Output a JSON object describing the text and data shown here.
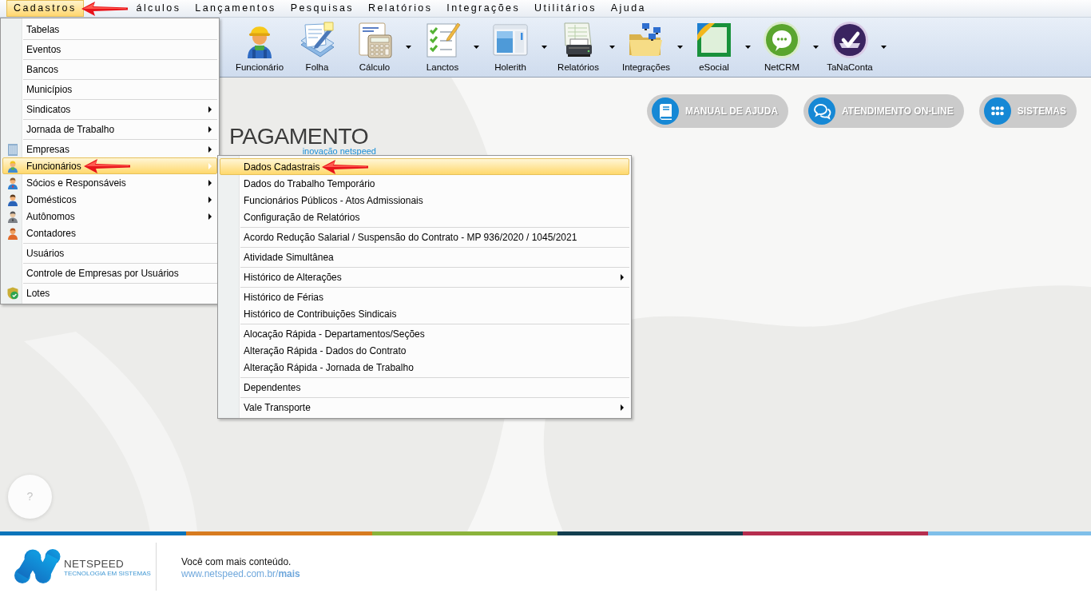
{
  "menubar": {
    "items": [
      {
        "label": "Cadastros",
        "selected": true,
        "marked": true
      },
      {
        "label": "álculos",
        "selected": false,
        "marked": false
      },
      {
        "label": "Lançamentos",
        "selected": false,
        "marked": false
      },
      {
        "label": "Pesquisas",
        "selected": false,
        "marked": false
      },
      {
        "label": "Relatórios",
        "selected": false,
        "marked": false
      },
      {
        "label": "Integrações",
        "selected": false,
        "marked": false
      },
      {
        "label": "Utilitários",
        "selected": false,
        "marked": false
      },
      {
        "label": "Ajuda",
        "selected": false,
        "marked": false
      }
    ]
  },
  "toolbar": {
    "items": [
      {
        "label": "Funcionário",
        "kind": "employee",
        "dropdown": false
      },
      {
        "label": "Folha",
        "kind": "payroll",
        "dropdown": false
      },
      {
        "label": "Cálculo",
        "kind": "calculator",
        "dropdown": true
      },
      {
        "label": "Lanctos",
        "kind": "checklist",
        "dropdown": true
      },
      {
        "label": "Holerith",
        "kind": "window",
        "dropdown": true
      },
      {
        "label": "Relatórios",
        "kind": "printer",
        "dropdown": true
      },
      {
        "label": "Integrações",
        "kind": "network-folder",
        "dropdown": true
      },
      {
        "label": "eSocial",
        "kind": "corner-document",
        "dropdown": true
      },
      {
        "label": "NetCRM",
        "kind": "chat",
        "dropdown": true
      },
      {
        "label": "TaNaConta",
        "kind": "check-badge",
        "dropdown": true
      }
    ]
  },
  "quick_links": [
    {
      "label": "MANUAL DE AJUDA",
      "kind": "manual"
    },
    {
      "label": "ATENDIMENTO ON-LINE",
      "kind": "chat"
    },
    {
      "label": "SISTEMAS",
      "kind": "apps"
    }
  ],
  "product_logo": {
    "title": "PAGAMENTO",
    "tagline": "inovação netspeed"
  },
  "help_button": {
    "label": "?"
  },
  "menu": {
    "groups": [
      {
        "items": [
          {
            "label": "Tabelas",
            "kind": "plain",
            "submenu": false,
            "selected": false,
            "marked": false
          }
        ]
      },
      {
        "items": [
          {
            "label": "Eventos",
            "kind": "plain",
            "submenu": false,
            "selected": false,
            "marked": false
          }
        ]
      },
      {
        "items": [
          {
            "label": "Bancos",
            "kind": "plain",
            "submenu": false,
            "selected": false,
            "marked": false
          }
        ]
      },
      {
        "items": [
          {
            "label": "Municípios",
            "kind": "plain",
            "submenu": false,
            "selected": false,
            "marked": false
          }
        ]
      },
      {
        "items": [
          {
            "label": "Sindicatos",
            "kind": "plain",
            "submenu": true,
            "selected": false,
            "marked": false
          }
        ]
      },
      {
        "items": [
          {
            "label": "Jornada de Trabalho",
            "kind": "plain",
            "submenu": true,
            "selected": false,
            "marked": false
          }
        ]
      },
      {
        "items": [
          {
            "label": "Empresas",
            "kind": "company",
            "submenu": true,
            "selected": false,
            "marked": false
          },
          {
            "label": "Funcionários",
            "kind": "employee",
            "submenu": true,
            "selected": true,
            "marked": true
          },
          {
            "label": "Sócios e Responsáveis",
            "kind": "partner",
            "submenu": true,
            "selected": false,
            "marked": false
          },
          {
            "label": "Domésticos",
            "kind": "domestic",
            "submenu": true,
            "selected": false,
            "marked": false
          },
          {
            "label": "Autônomos",
            "kind": "freelancer",
            "submenu": true,
            "selected": false,
            "marked": false
          },
          {
            "label": "Contadores",
            "kind": "accountant",
            "submenu": false,
            "selected": false,
            "marked": false
          }
        ]
      },
      {
        "items": [
          {
            "label": "Usuários",
            "kind": "plain",
            "submenu": false,
            "selected": false,
            "marked": false
          }
        ]
      },
      {
        "items": [
          {
            "label": "Controle de Empresas por Usuários",
            "kind": "plain",
            "submenu": false,
            "selected": false,
            "marked": false
          }
        ]
      },
      {
        "items": [
          {
            "label": "Lotes",
            "kind": "batch",
            "submenu": false,
            "selected": false,
            "marked": false
          }
        ]
      }
    ]
  },
  "submenu": {
    "groups": [
      {
        "items": [
          {
            "label": "Dados Cadastrais",
            "submenu": false,
            "selected": true,
            "marked": true
          },
          {
            "label": "Dados do Trabalho Temporário",
            "submenu": false,
            "selected": false,
            "marked": false
          },
          {
            "label": "Funcionários Públicos - Atos Admissionais",
            "submenu": false,
            "selected": false,
            "marked": false
          },
          {
            "label": "Configuração de Relatórios",
            "submenu": false,
            "selected": false,
            "marked": false
          }
        ]
      },
      {
        "items": [
          {
            "label": "Acordo Redução Salarial / Suspensão do Contrato - MP 936/2020 / 1045/2021",
            "submenu": false,
            "selected": false,
            "marked": false
          }
        ]
      },
      {
        "items": [
          {
            "label": "Atividade Simultânea",
            "submenu": false,
            "selected": false,
            "marked": false
          }
        ]
      },
      {
        "items": [
          {
            "label": "Histórico de Alterações",
            "submenu": true,
            "selected": false,
            "marked": false
          }
        ]
      },
      {
        "items": [
          {
            "label": "Histórico de Férias",
            "submenu": false,
            "selected": false,
            "marked": false
          },
          {
            "label": "Histórico de Contribuições Sindicais",
            "submenu": false,
            "selected": false,
            "marked": false
          }
        ]
      },
      {
        "items": [
          {
            "label": "Alocação Rápida - Departamentos/Seções",
            "submenu": false,
            "selected": false,
            "marked": false
          },
          {
            "label": "Alteração Rápida - Dados do Contrato",
            "submenu": false,
            "selected": false,
            "marked": false
          },
          {
            "label": "Alteração Rápida - Jornada de Trabalho",
            "submenu": false,
            "selected": false,
            "marked": false
          }
        ]
      },
      {
        "items": [
          {
            "label": "Dependentes",
            "submenu": false,
            "selected": false,
            "marked": false
          }
        ]
      },
      {
        "items": [
          {
            "label": "Vale Transporte",
            "submenu": true,
            "selected": false,
            "marked": false
          }
        ]
      }
    ]
  },
  "footer": {
    "logo_name": "NETSPEED",
    "logo_tagline": "TECNOLOGIA EM SISTEMAS",
    "message": "Você com mais conteúdo.",
    "link": "www.netspeed.com.br/**mais**"
  }
}
